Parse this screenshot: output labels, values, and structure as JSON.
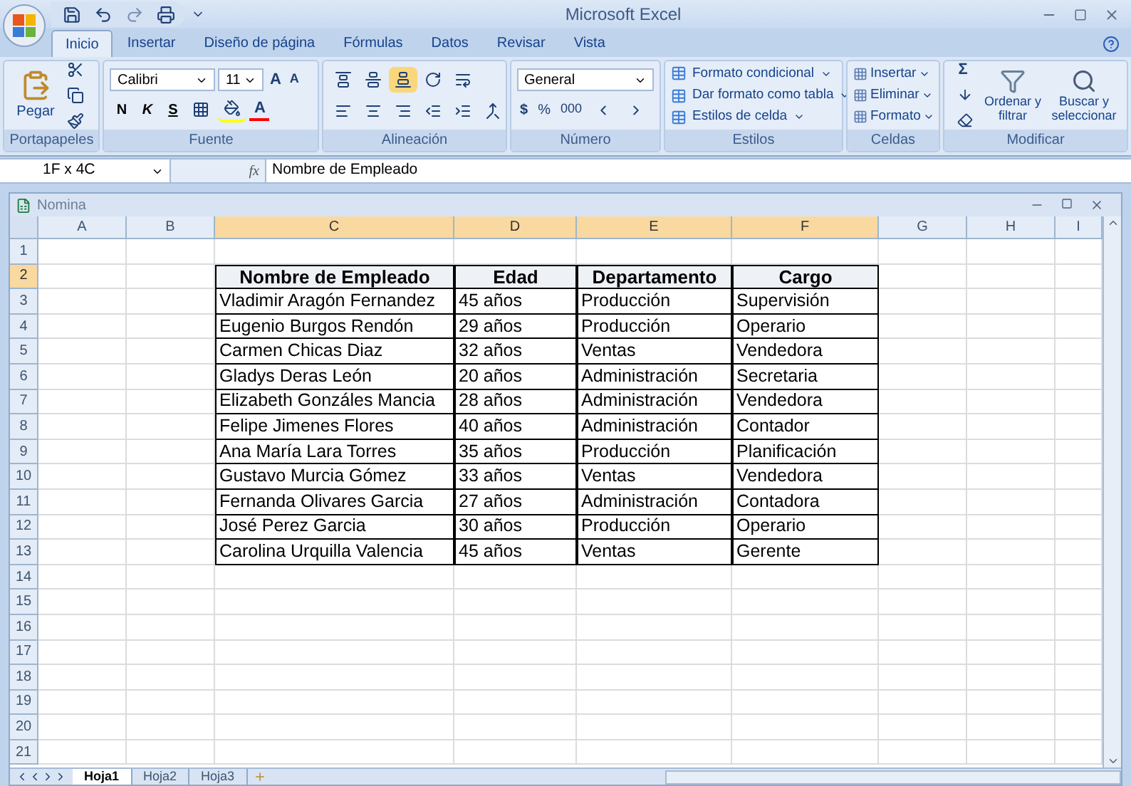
{
  "app_title": "Microsoft Excel",
  "ribbon_tabs": [
    {
      "label": "Inicio",
      "selected": true
    },
    {
      "label": "Insertar",
      "selected": false
    },
    {
      "label": "Diseño de página",
      "selected": false
    },
    {
      "label": "Fórmulas",
      "selected": false
    },
    {
      "label": "Datos",
      "selected": false
    },
    {
      "label": "Revisar",
      "selected": false
    },
    {
      "label": "Vista",
      "selected": false
    }
  ],
  "clipboard": {
    "label": "Portapapeles",
    "paste": "Pegar"
  },
  "font": {
    "label": "Fuente",
    "font_name": "Calibri",
    "font_size": "11",
    "bold": "N",
    "italic": "K",
    "underline": "S",
    "grow": "A",
    "shrink": "A",
    "font_color_letter": "A"
  },
  "alignment": {
    "label": "Alineación"
  },
  "number": {
    "label": "Número",
    "format": "General",
    "currency": "$",
    "percent": "%",
    "thousands": "000"
  },
  "styles": {
    "label": "Estilos",
    "items": [
      "Formato condicional",
      "Dar formato como tabla",
      "Estilos de celda"
    ]
  },
  "cells_group": {
    "label": "Celdas",
    "items": [
      "Insertar",
      "Eliminar",
      "Formato"
    ]
  },
  "editing": {
    "label": "Modificar",
    "sum": "Σ",
    "sort": "Ordenar y filtrar",
    "find": "Buscar y seleccionar"
  },
  "formula_bar": {
    "name_box": "1F x 4C",
    "fx": "fx",
    "value": "Nombre de Empleado"
  },
  "workbook": {
    "title": "Nomina"
  },
  "columns": [
    {
      "label": "A",
      "selected": false
    },
    {
      "label": "B",
      "selected": false
    },
    {
      "label": "C",
      "selected": true
    },
    {
      "label": "D",
      "selected": true
    },
    {
      "label": "E",
      "selected": true
    },
    {
      "label": "F",
      "selected": true
    },
    {
      "label": "G",
      "selected": false
    },
    {
      "label": "H",
      "selected": false
    },
    {
      "label": "I",
      "selected": false
    }
  ],
  "rows": [
    {
      "number": "1",
      "selected": false,
      "kind": "empty"
    },
    {
      "number": "2",
      "selected": true,
      "kind": "header",
      "values": [
        "Nombre de Empleado",
        "Edad",
        "Departamento",
        "Cargo"
      ]
    },
    {
      "number": "3",
      "selected": false,
      "kind": "data",
      "values": [
        "Vladimir Aragón Fernandez",
        "45 años",
        "Producción",
        "Supervisión"
      ]
    },
    {
      "number": "4",
      "selected": false,
      "kind": "data",
      "values": [
        "Eugenio Burgos Rendón",
        "29 años",
        "Producción",
        "Operario"
      ]
    },
    {
      "number": "5",
      "selected": false,
      "kind": "data",
      "values": [
        "Carmen Chicas Diaz",
        "32 años",
        "Ventas",
        "Vendedora"
      ]
    },
    {
      "number": "6",
      "selected": false,
      "kind": "data",
      "values": [
        "Gladys Deras León",
        "20 años",
        "Administración",
        "Secretaria"
      ]
    },
    {
      "number": "7",
      "selected": false,
      "kind": "data",
      "values": [
        "Elizabeth Gonzáles Mancia",
        "28 años",
        "Administración",
        "Vendedora"
      ]
    },
    {
      "number": "8",
      "selected": false,
      "kind": "data",
      "values": [
        "Felipe Jimenes Flores",
        "40 años",
        "Administración",
        "Contador"
      ]
    },
    {
      "number": "9",
      "selected": false,
      "kind": "data",
      "values": [
        "Ana María Lara Torres",
        "35 años",
        "Producción",
        "Planificación"
      ]
    },
    {
      "number": "10",
      "selected": false,
      "kind": "data",
      "values": [
        "Gustavo Murcia Gómez",
        "33 años",
        "Ventas",
        "Vendedora"
      ]
    },
    {
      "number": "11",
      "selected": false,
      "kind": "data",
      "values": [
        "Fernanda Olivares Garcia",
        "27 años",
        "Administración",
        "Contadora"
      ]
    },
    {
      "number": "12",
      "selected": false,
      "kind": "data",
      "values": [
        "José Perez Garcia",
        "30 años",
        "Producción",
        "Operario"
      ]
    },
    {
      "number": "13",
      "selected": false,
      "kind": "data",
      "values": [
        "Carolina Urquilla Valencia",
        "45 años",
        "Ventas",
        "Gerente"
      ]
    },
    {
      "number": "14",
      "selected": false,
      "kind": "empty"
    },
    {
      "number": "15",
      "selected": false,
      "kind": "empty"
    },
    {
      "number": "16",
      "selected": false,
      "kind": "empty"
    },
    {
      "number": "17",
      "selected": false,
      "kind": "empty"
    },
    {
      "number": "18",
      "selected": false,
      "kind": "empty"
    },
    {
      "number": "19",
      "selected": false,
      "kind": "empty"
    },
    {
      "number": "20",
      "selected": false,
      "kind": "empty"
    },
    {
      "number": "21",
      "selected": false,
      "kind": "empty"
    }
  ],
  "sheet_tabs": [
    {
      "label": "Hoja1",
      "selected": true
    },
    {
      "label": "Hoja2",
      "selected": false
    },
    {
      "label": "Hoja3",
      "selected": false
    }
  ]
}
